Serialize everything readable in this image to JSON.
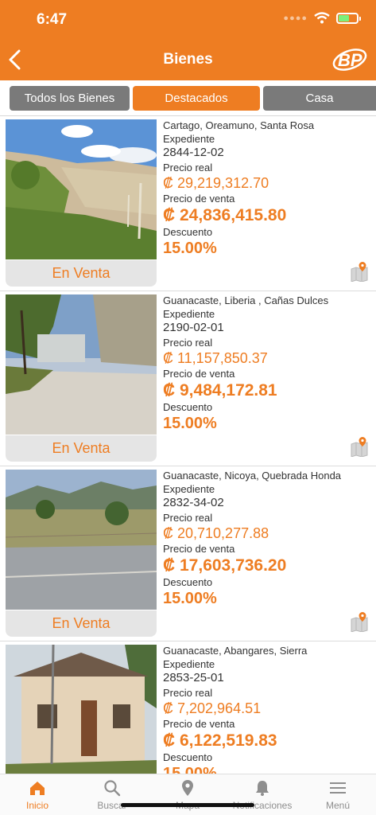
{
  "status_bar": {
    "time": "6:47"
  },
  "header": {
    "title": "Bienes"
  },
  "tabs": [
    "Todos los Bienes",
    "Destacados",
    "Casa"
  ],
  "labels": {
    "expediente": "Expediente",
    "precio_real": "Precio real",
    "precio_venta": "Precio de venta",
    "descuento": "Descuento"
  },
  "properties": [
    {
      "location": "Cartago, Oreamuno, Santa Rosa",
      "expediente": "2844-12-02",
      "precio_real": "₡ 29,219,312.70",
      "precio_venta": "₡ 24,836,415.80",
      "descuento": "15.00%",
      "status": "En Venta"
    },
    {
      "location": "Guanacaste, Liberia , Cañas Dulces",
      "expediente": "2190-02-01",
      "precio_real": "₡ 11,157,850.37",
      "precio_venta": "₡ 9,484,172.81",
      "descuento": "15.00%",
      "status": "En Venta"
    },
    {
      "location": "Guanacaste, Nicoya, Quebrada Honda",
      "expediente": "2832-34-02",
      "precio_real": "₡ 20,710,277.88",
      "precio_venta": "₡ 17,603,736.20",
      "descuento": "15.00%",
      "status": "En Venta"
    },
    {
      "location": "Guanacaste, Abangares, Sierra",
      "expediente": "2853-25-01",
      "precio_real": "₡ 7,202,964.51",
      "precio_venta": "₡ 6,122,519.83",
      "descuento": "15.00%"
    }
  ],
  "tabbar": [
    {
      "label": "Inicio",
      "icon": "home-icon"
    },
    {
      "label": "Buscar",
      "icon": "search-icon"
    },
    {
      "label": "Mapa",
      "icon": "map-pin-icon"
    },
    {
      "label": "Notificaciones",
      "icon": "bell-icon"
    },
    {
      "label": "Menú",
      "icon": "menu-icon"
    }
  ],
  "colors": {
    "accent": "#ee7d22",
    "tab_inactive": "#7a7a7a"
  }
}
